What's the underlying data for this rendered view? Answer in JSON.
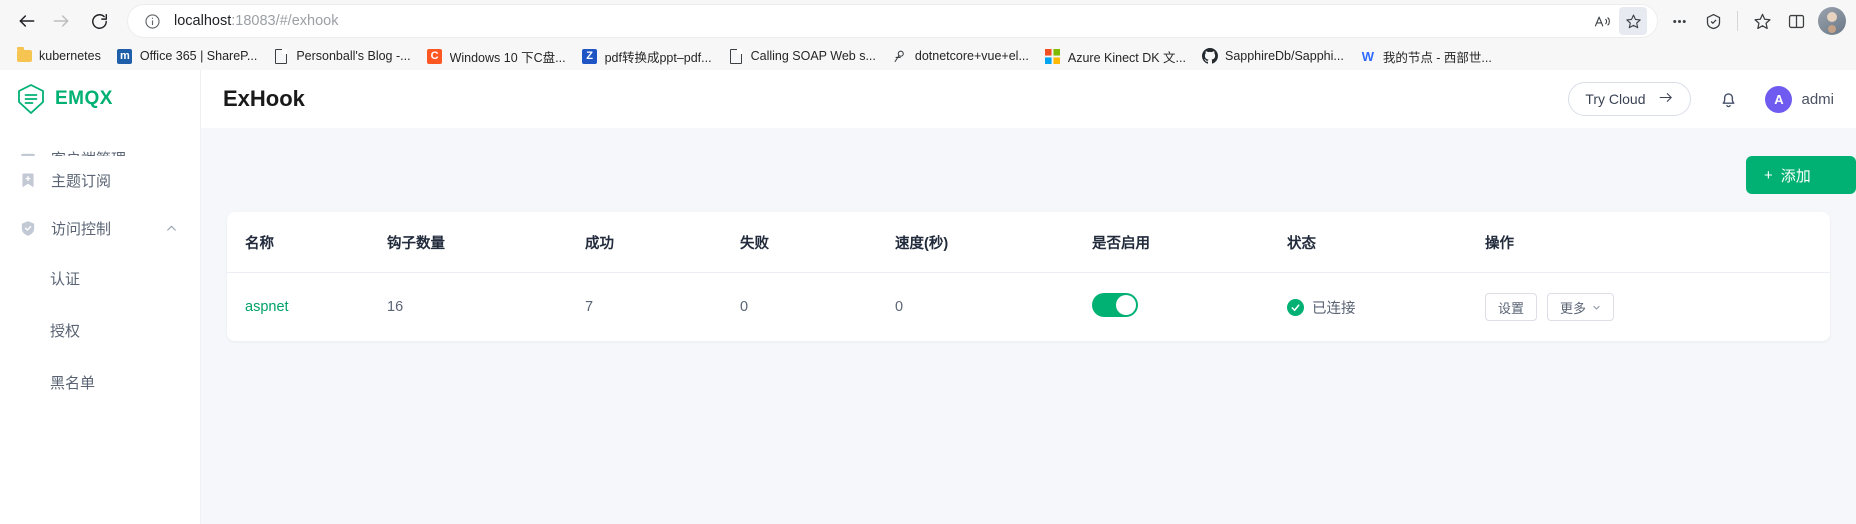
{
  "browser": {
    "back_label": "Back",
    "forward_label": "Forward",
    "reload_label": "Refresh",
    "url_host": "localhost",
    "url_rest": ":18083/#/exhook",
    "url_full": "localhost:18083/#/exhook",
    "omnibox_icons": [
      "info-icon",
      "read-aloud-icon",
      "favorite-icon"
    ],
    "toolbar_icons": [
      "collections-icon",
      "browser-essentials-icon",
      "favorites-icon",
      "split-screen-icon"
    ],
    "bookmarks": [
      {
        "label": "kubernetes",
        "icon": "folder-icon",
        "icon_kind": "folder",
        "color": "#f5c451",
        "glyph": ""
      },
      {
        "label": "Office 365 | ShareP...",
        "icon": "office365-icon",
        "icon_kind": "square",
        "color": "#1f5faa",
        "glyph": "m"
      },
      {
        "label": "Personball's Blog -...",
        "icon": "page-icon",
        "icon_kind": "page",
        "color": "#3c4043",
        "glyph": ""
      },
      {
        "label": "Windows 10 下C盘...",
        "icon": "cnblogs-icon",
        "icon_kind": "square",
        "color": "#ff5722",
        "glyph": "C"
      },
      {
        "label": "pdf转换成ppt–pdf...",
        "icon": "zhihu-icon",
        "icon_kind": "square",
        "color": "#1e54c4",
        "glyph": "Z"
      },
      {
        "label": "Calling SOAP Web s...",
        "icon": "page-icon",
        "icon_kind": "page",
        "color": "#3c4043",
        "glyph": ""
      },
      {
        "label": "dotnetcore+vue+el...",
        "icon": "segmentfault-icon",
        "icon_kind": "glyph",
        "color": "#3c4043",
        "glyph": "ꝗ"
      },
      {
        "label": "Azure Kinect DK 文...",
        "icon": "microsoft-icon",
        "icon_kind": "microsoft",
        "color": "",
        "glyph": ""
      },
      {
        "label": "SapphireDb/Sapphi...",
        "icon": "github-icon",
        "icon_kind": "github",
        "color": "#24292e",
        "glyph": ""
      },
      {
        "label": "我的节点 - 西部世...",
        "icon": "w-icon",
        "icon_kind": "glyph",
        "color": "#2f6bff",
        "glyph": "W"
      }
    ]
  },
  "app": {
    "brand": "EMQX",
    "sidebar": {
      "items": [
        {
          "label": "客户端管理",
          "icon": "clients-icon",
          "clipped": true,
          "expandable": false
        },
        {
          "label": "主题订阅",
          "icon": "subscriptions-icon",
          "clipped": false,
          "expandable": false
        },
        {
          "label": "访问控制",
          "icon": "shield-icon",
          "clipped": false,
          "expandable": true,
          "chevron": "up"
        }
      ],
      "sub_items": [
        {
          "label": "认证"
        },
        {
          "label": "授权"
        },
        {
          "label": "黑名单"
        }
      ]
    },
    "header": {
      "title": "ExHook",
      "try_cloud_label": "Try Cloud",
      "try_cloud_arrow": "→",
      "notification_icon": "bell-icon",
      "avatar_initial": "A",
      "user_name": "admi"
    },
    "toolbar": {
      "add_label": "添加",
      "add_plus": "+"
    },
    "table": {
      "columns": [
        {
          "key": "name",
          "label": "名称"
        },
        {
          "key": "hooks",
          "label": "钩子数量"
        },
        {
          "key": "success",
          "label": "成功"
        },
        {
          "key": "failure",
          "label": "失败"
        },
        {
          "key": "speed",
          "label": "速度(秒)"
        },
        {
          "key": "enabled",
          "label": "是否启用"
        },
        {
          "key": "status",
          "label": "状态"
        },
        {
          "key": "ops",
          "label": "操作"
        }
      ],
      "rows": [
        {
          "name": "aspnet",
          "hooks": "16",
          "success": "7",
          "failure": "0",
          "speed": "0",
          "enabled": true,
          "status_text": "已连接",
          "status_color": "#00b173",
          "ops_settings": "设置",
          "ops_more": "更多",
          "ops_more_caret": "▾"
        }
      ]
    },
    "colors": {
      "brand_green": "#00b173",
      "link_green": "#00a26a",
      "page_bg": "#f5f7fa",
      "avatar_purple": "#6f5bf0"
    }
  }
}
